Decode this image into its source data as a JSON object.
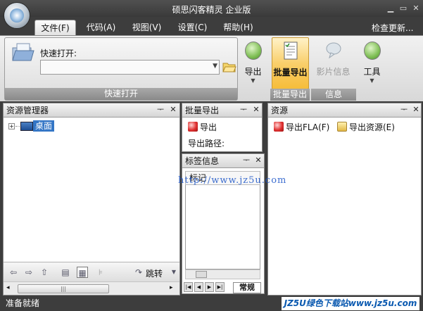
{
  "app": {
    "title": "硕思闪客精灵 企业版",
    "min_icon": "minimize-icon",
    "max_icon": "maximize-icon",
    "close_icon": "close-icon"
  },
  "menu_tabs": [
    {
      "label": "文件(F)",
      "active": true
    },
    {
      "label": "代码(A)"
    },
    {
      "label": "视图(V)"
    },
    {
      "label": "设置(C)"
    },
    {
      "label": "帮助(H)"
    }
  ],
  "check_update": "检查更新...",
  "ribbon": {
    "quick_open_label": "快速打开:",
    "quick_open_value": "",
    "quick_group": "快速打开",
    "export_label": "导出",
    "batch_export_label": "批量导出",
    "movie_info_label": "影片信息",
    "tools_label": "工具",
    "batch_group": "批量导出",
    "info_group": "信息"
  },
  "explorer": {
    "title": "资源管理器",
    "tree_root": "桌面",
    "jump_label": "跳转"
  },
  "batch_panel": {
    "title": "批量导出",
    "export_label": "导出",
    "path_label": "导出路径:"
  },
  "tags_panel": {
    "title": "标签信息",
    "column_header": "标记",
    "tab_normal": "常规"
  },
  "resources": {
    "title": "资源",
    "export_fla": "导出FLA(F)",
    "export_resources": "导出资源(E)"
  },
  "status": "准备就绪",
  "watermark": {
    "url": "http://www.jz5u.com",
    "box": "JZ5U绿色下载站www.jz5u.com"
  },
  "colors": {
    "chrome_dark": "#3d3d3d",
    "highlight_orange": "#f9cf6b",
    "tree_selection": "#3476c6"
  }
}
